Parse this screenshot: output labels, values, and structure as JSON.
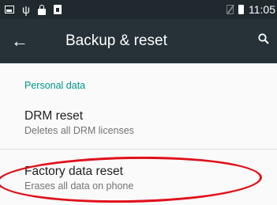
{
  "status_bar": {
    "time": "11:05",
    "left_icons": [
      "image-icon",
      "usb-icon",
      "lock-icon",
      "bag-icon"
    ],
    "right_icons": [
      "no-sim-icon",
      "battery-icon"
    ]
  },
  "app_bar": {
    "back_icon": "arrow-left-icon",
    "title": "Backup & reset",
    "search_icon": "search-icon",
    "background": "#263238"
  },
  "sections": [
    {
      "header": "Personal data",
      "items": [
        {
          "title": "DRM reset",
          "subtitle": "Deletes all DRM licenses"
        },
        {
          "title": "Factory data reset",
          "subtitle": "Erases all data on phone"
        }
      ]
    }
  ],
  "accent_color": "#009688",
  "highlight_color": "#e0101a"
}
